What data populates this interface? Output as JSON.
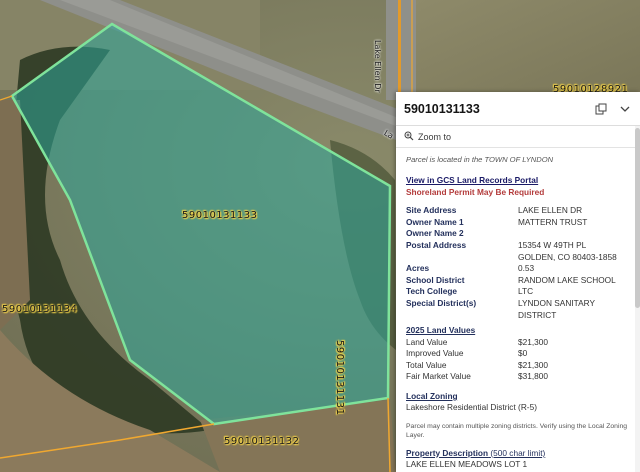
{
  "map": {
    "parcel_labels": {
      "main": "59010131133",
      "west": "59010131134",
      "south": "59010131132",
      "east": "59010131131",
      "northeast": "59010128921"
    },
    "road_labels": {
      "vertical": "Lake Ellen Dr",
      "diagonal": "La"
    },
    "colors": {
      "parcel_outline": "#7fe39b",
      "parcel_fill": "#2ea89a",
      "parcel_lines": "#f0a830"
    }
  },
  "popup": {
    "title": "59010131133",
    "zoom_label": "Zoom to",
    "located_note": "Parcel is located in the TOWN OF LYNDON",
    "portal_link": "View in GCS Land Records Portal",
    "shoreland_warning": "Shoreland Permit May Be Required",
    "attributes": [
      {
        "key": "Site Address",
        "value": "LAKE ELLEN DR"
      },
      {
        "key": "Owner Name 1",
        "value": "MATTERN TRUST"
      },
      {
        "key": "Owner Name 2",
        "value": ""
      },
      {
        "key": "Postal Address",
        "value": "15354 W 49TH PL"
      },
      {
        "key": "",
        "value": "GOLDEN, CO 80403-1858"
      },
      {
        "key": "Acres",
        "value": "0.53"
      },
      {
        "key": "School District",
        "value": "RANDOM LAKE SCHOOL"
      },
      {
        "key": "Tech College",
        "value": "LTC"
      },
      {
        "key": "Special District(s)",
        "value": "LYNDON SANITARY DISTRICT"
      }
    ],
    "land_values_title": "2025 Land Values",
    "land_values": [
      {
        "key": "Land Value",
        "value": "$21,300"
      },
      {
        "key": "Improved Value",
        "value": "$0"
      },
      {
        "key": "Total Value",
        "value": "$21,300"
      },
      {
        "key": "Fair Market Value",
        "value": "$31,800"
      }
    ],
    "zoning_title": "Local Zoning",
    "zoning_value": "Lakeshore Residential District (R-5)",
    "zoning_note": "Parcel may contain multiple zoning districts. Verify using the Local Zoning Layer.",
    "property_desc_title": "Property Description",
    "property_desc_sub": "(500 char limit)",
    "property_desc_value": "LAKE ELLEN MEADOWS LOT 1"
  }
}
